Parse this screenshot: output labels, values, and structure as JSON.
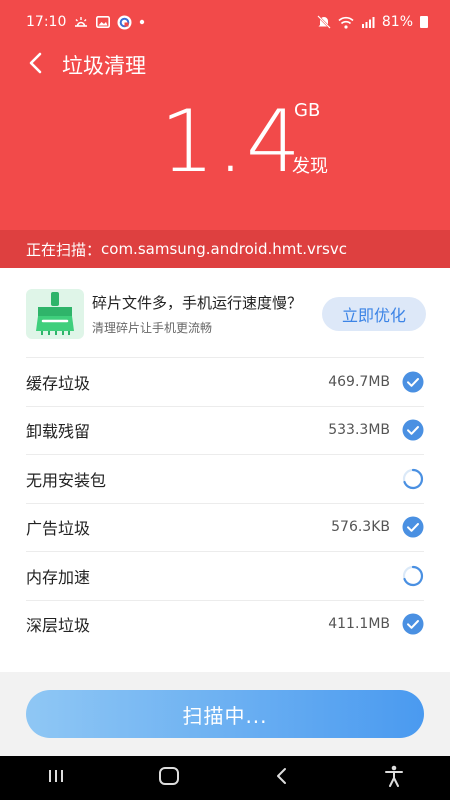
{
  "status_bar": {
    "time": "17:10",
    "battery": "81%"
  },
  "title": "垃圾清理",
  "summary": {
    "size": "1.4",
    "unit": "GB",
    "found_label": "发现"
  },
  "scan_status": {
    "label": "正在扫描：",
    "package": "com.samsung.android.hmt.vrsvc"
  },
  "tip": {
    "title": "碎片文件多，手机运行速度慢？",
    "subtitle": "清理碎片让手机更流畅",
    "button": "立即优化"
  },
  "items": [
    {
      "label": "缓存垃圾",
      "size": "469.7MB",
      "state": "done"
    },
    {
      "label": "卸载残留",
      "size": "533.3MB",
      "state": "done"
    },
    {
      "label": "无用安装包",
      "size": "",
      "state": "scanning"
    },
    {
      "label": "广告垃圾",
      "size": "576.3KB",
      "state": "done"
    },
    {
      "label": "内存加速",
      "size": "",
      "state": "scanning"
    },
    {
      "label": "深层垃圾",
      "size": "411.1MB",
      "state": "done"
    }
  ],
  "scan_button": "扫描中...",
  "colors": {
    "header": "#f24a4a",
    "strip": "#de4040",
    "accent": "#3c84e6",
    "check": "#4a90e2"
  },
  "icons": [
    "sunrise-icon",
    "image-icon",
    "app-icon",
    "mute-icon",
    "wifi-icon",
    "signal-icon",
    "battery-icon",
    "back-icon",
    "broom-icon",
    "check-icon",
    "spinner-icon",
    "recents-icon",
    "home-icon",
    "nav-back-icon",
    "accessibility-icon"
  ]
}
